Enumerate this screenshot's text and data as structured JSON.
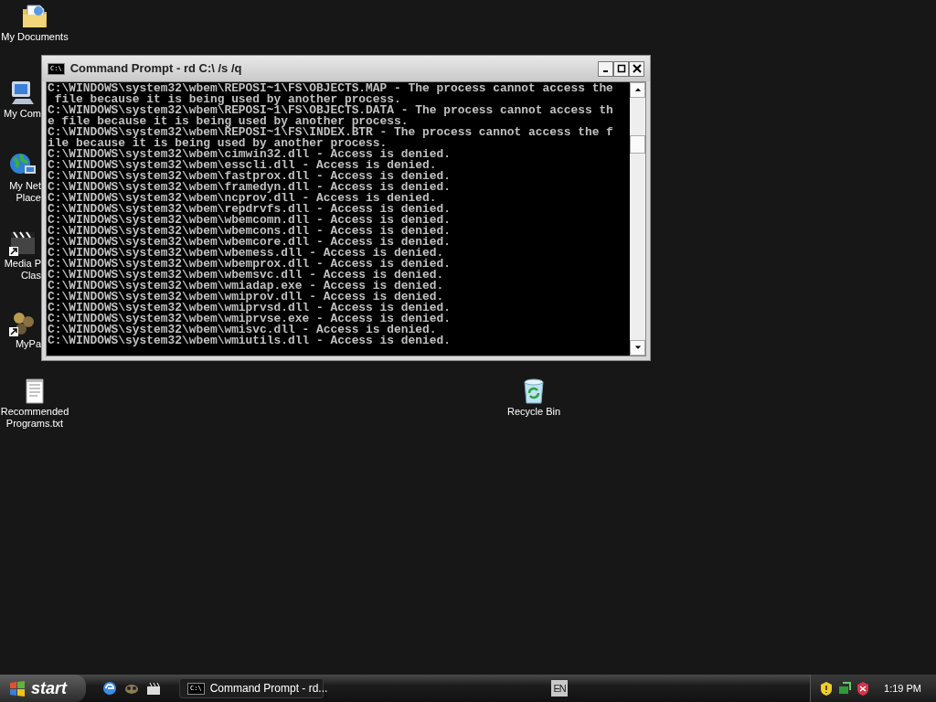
{
  "desktop_icons": [
    {
      "kind": "documents",
      "label_lines": [
        "My Documents"
      ],
      "partly_hidden": false
    },
    {
      "kind": "computer",
      "label_lines": [
        "My Com"
      ],
      "partly_hidden": true
    },
    {
      "kind": "network",
      "label_lines": [
        "My Net",
        "Place"
      ],
      "partly_hidden": true
    },
    {
      "kind": "media",
      "label_lines": [
        "Media P",
        "Clas"
      ],
      "partly_hidden": true
    },
    {
      "kind": "shortcut",
      "label_lines": [
        "MyPa"
      ],
      "partly_hidden": true
    },
    {
      "kind": "textfile",
      "label_lines": [
        "Recommended",
        "Programs.txt"
      ],
      "partly_hidden": false
    },
    {
      "kind": "recycle",
      "label_lines": [
        "Recycle Bin"
      ],
      "partly_hidden": false
    }
  ],
  "window": {
    "title": "Command Prompt - rd C:\\ /s /q",
    "console_lines": [
      "C:\\WINDOWS\\system32\\wbem\\REPOSI~1\\FS\\OBJECTS.MAP - The process cannot access the",
      " file because it is being used by another process.",
      "C:\\WINDOWS\\system32\\wbem\\REPOSI~1\\FS\\OBJECTS.DATA - The process cannot access th",
      "e file because it is being used by another process.",
      "C:\\WINDOWS\\system32\\wbem\\REPOSI~1\\FS\\INDEX.BTR - The process cannot access the f",
      "ile because it is being used by another process.",
      "C:\\WINDOWS\\system32\\wbem\\cimwin32.dll - Access is denied.",
      "C:\\WINDOWS\\system32\\wbem\\esscli.dll - Access is denied.",
      "C:\\WINDOWS\\system32\\wbem\\fastprox.dll - Access is denied.",
      "C:\\WINDOWS\\system32\\wbem\\framedyn.dll - Access is denied.",
      "C:\\WINDOWS\\system32\\wbem\\ncprov.dll - Access is denied.",
      "C:\\WINDOWS\\system32\\wbem\\repdrvfs.dll - Access is denied.",
      "C:\\WINDOWS\\system32\\wbem\\wbemcomn.dll - Access is denied.",
      "C:\\WINDOWS\\system32\\wbem\\wbemcons.dll - Access is denied.",
      "C:\\WINDOWS\\system32\\wbem\\wbemcore.dll - Access is denied.",
      "C:\\WINDOWS\\system32\\wbem\\wbemess.dll - Access is denied.",
      "C:\\WINDOWS\\system32\\wbem\\wbemprox.dll - Access is denied.",
      "C:\\WINDOWS\\system32\\wbem\\wbemsvc.dll - Access is denied.",
      "C:\\WINDOWS\\system32\\wbem\\wmiadap.exe - Access is denied.",
      "C:\\WINDOWS\\system32\\wbem\\wmiprov.dll - Access is denied.",
      "C:\\WINDOWS\\system32\\wbem\\wmiprvsd.dll - Access is denied.",
      "C:\\WINDOWS\\system32\\wbem\\wmiprvse.exe - Access is denied.",
      "C:\\WINDOWS\\system32\\wbem\\wmisvc.dll - Access is denied.",
      "C:\\WINDOWS\\system32\\wbem\\wmiutils.dll - Access is denied."
    ],
    "title_icon": "C:\\"
  },
  "taskbar": {
    "start_label": "start",
    "quick_launch": [
      {
        "kind": "ie"
      },
      {
        "kind": "raccoon"
      },
      {
        "kind": "clapper"
      }
    ],
    "tasks": [
      {
        "icon": "C:\\",
        "label": "Command Prompt - rd...",
        "selected": false
      }
    ],
    "language": "EN",
    "tray": [
      {
        "kind": "shield-warning"
      },
      {
        "kind": "network"
      },
      {
        "kind": "shield-alert"
      }
    ],
    "clock": "1:19 PM"
  }
}
